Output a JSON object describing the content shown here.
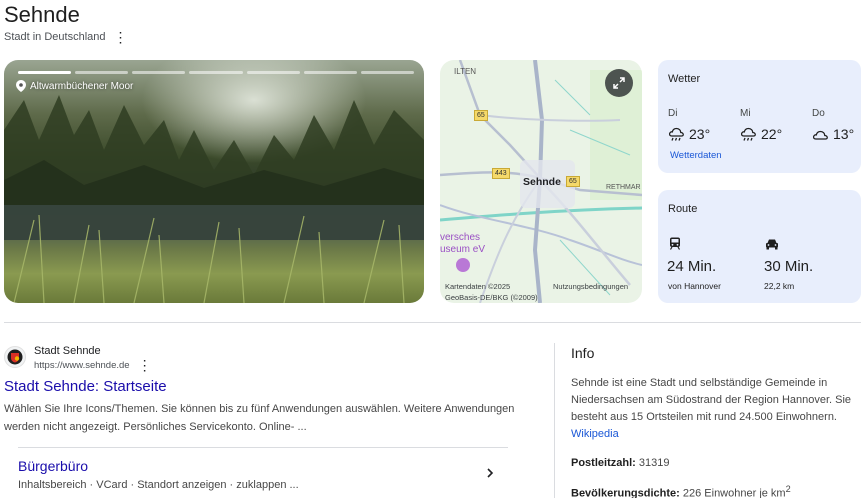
{
  "header": {
    "title": "Sehnde",
    "subtitle": "Stadt in Deutschland"
  },
  "photo": {
    "location": "Altwarmbüchener Moor",
    "progress_total": 7,
    "progress_active": 1
  },
  "map": {
    "labels": {
      "city": "Sehnde",
      "ilten": "ILTEN",
      "rethmar": "RETHMAR",
      "museum_1": "versches",
      "museum_2": "useum eV"
    },
    "roads": {
      "r65a": "65",
      "r65b": "65",
      "r443": "443"
    },
    "footer": {
      "copyright": "Kartendaten ©2025",
      "terms": "Nutzungsbedingungen",
      "source": "GeoBasis-DE/BKG (©2009)"
    }
  },
  "weather": {
    "title": "Wetter",
    "days": [
      {
        "day": "Di",
        "temp": "23°",
        "icon": "rain-cloud-icon"
      },
      {
        "day": "Mi",
        "temp": "22°",
        "icon": "rain-cloud-icon"
      },
      {
        "day": "Do",
        "temp": "13°",
        "icon": "cloud-icon"
      }
    ],
    "link": "Wetterdaten"
  },
  "route": {
    "title": "Route",
    "modes": [
      {
        "icon": "train-icon",
        "time": "24 Min.",
        "sub": "von Hannover"
      },
      {
        "icon": "car-icon",
        "time": "30 Min.",
        "sub": "22,2 km"
      }
    ]
  },
  "result": {
    "site_name": "Stadt Sehnde",
    "url": "https://www.sehnde.de",
    "title": "Stadt Sehnde: Startseite",
    "snippet": "Wählen Sie Ihre Icons/Themen. Sie können bis zu fünf Anwendungen auswählen. Weitere Anwendungen werden nicht angezeigt. Persönliches Servicekonto. Online- ...",
    "sublink": {
      "title": "Bürgerbüro",
      "snippet": "Inhaltsbereich · VCard · Standort anzeigen · zuklappen ..."
    }
  },
  "info": {
    "title": "Info",
    "text": "Sehnde ist eine Stadt und selbständige Gemeinde in Niedersachsen am Südostrand der Region Hannover. Sie besteht aus 15 Ortsteilen mit rund 24.500 Einwohnern.",
    "link": "Wikipedia",
    "facts": [
      {
        "label": "Postleitzahl:",
        "value": "31319"
      },
      {
        "label": "Bevölkerungsdichte:",
        "value": "226 Einwohner je km",
        "sup": "2"
      }
    ]
  }
}
